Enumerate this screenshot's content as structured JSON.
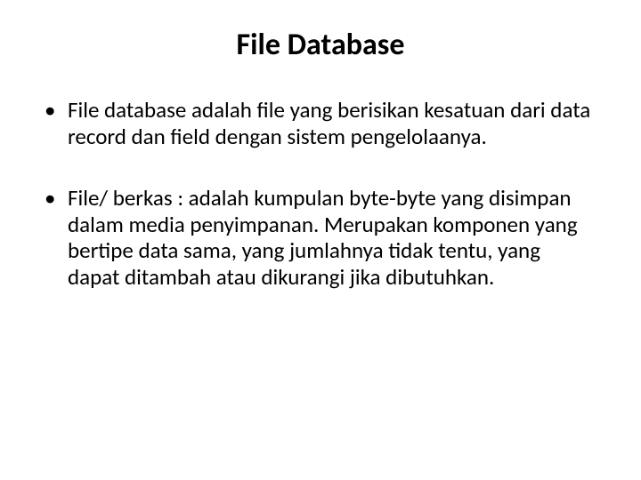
{
  "slide": {
    "title": "File Database",
    "bullets": [
      "File database adalah file yang berisikan kesatuan dari data record dan field dengan sistem pengelolaanya.",
      "File/ berkas : adalah kumpulan byte-byte yang disimpan dalam media penyimpanan. Merupakan komponen yang bertipe data sama, yang jumlahnya tidak tentu, yang dapat ditambah atau dikurangi jika dibutuhkan."
    ]
  }
}
